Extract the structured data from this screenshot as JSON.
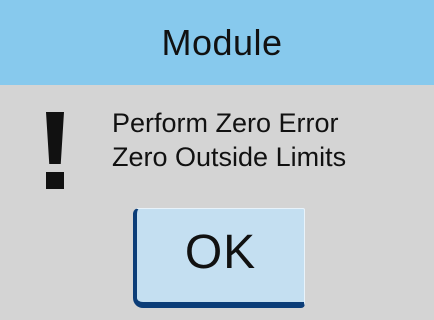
{
  "dialog": {
    "title": "Module",
    "icon": "exclamation-icon",
    "message_lines": [
      "Perform Zero Error",
      "Zero Outside Limits"
    ],
    "ok_label": "OK"
  },
  "colors": {
    "title_bar": "#87c9ed",
    "background": "#d4d4d4",
    "button_face": "#c4dff1",
    "button_border": "#0b3d78",
    "text": "#111111"
  }
}
